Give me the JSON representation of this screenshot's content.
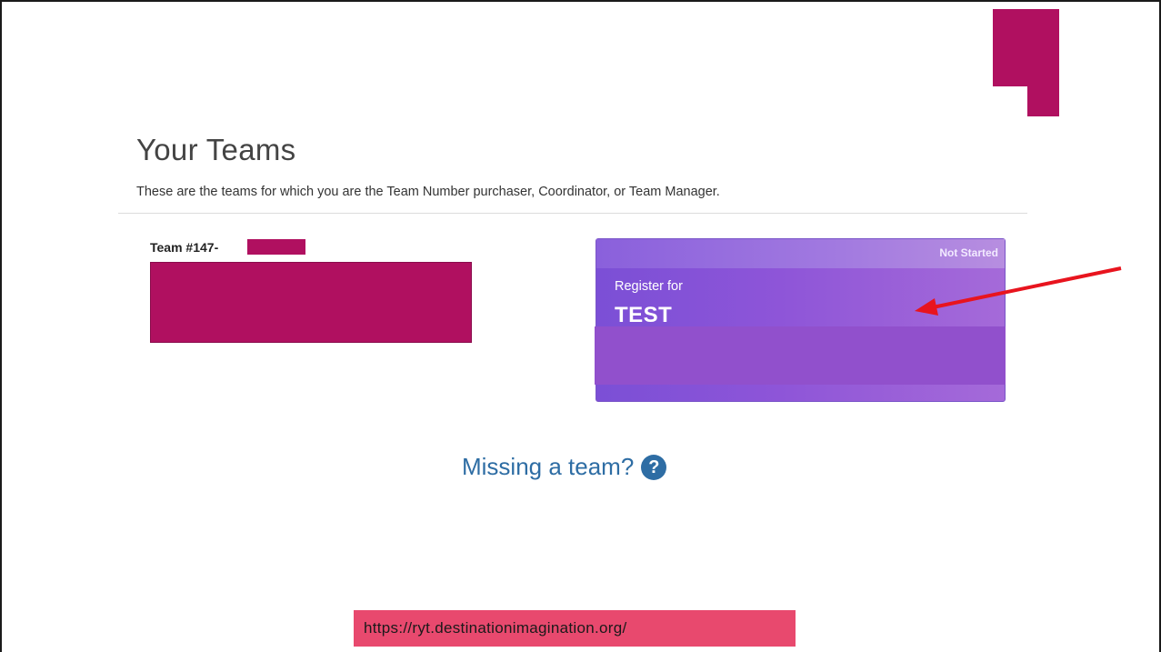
{
  "header": {
    "title": "Your Teams",
    "subtitle": "These are the teams for which you are the Team Number purchaser, Coordinator, or Team Manager."
  },
  "team": {
    "name": "Team #147-"
  },
  "registration_card": {
    "status": "Not Started",
    "label": "Register for",
    "event": "TEST"
  },
  "missing_team": {
    "text": "Missing a team?",
    "icon": "question-circle-icon",
    "color": "#2e6da4"
  },
  "url_banner": {
    "text": "https://ryt.destinationimagination.org/"
  },
  "colors": {
    "accent": "#b01060",
    "card": "#8e55d8",
    "arrow": "#e8141e",
    "banner": "#e8496e"
  }
}
